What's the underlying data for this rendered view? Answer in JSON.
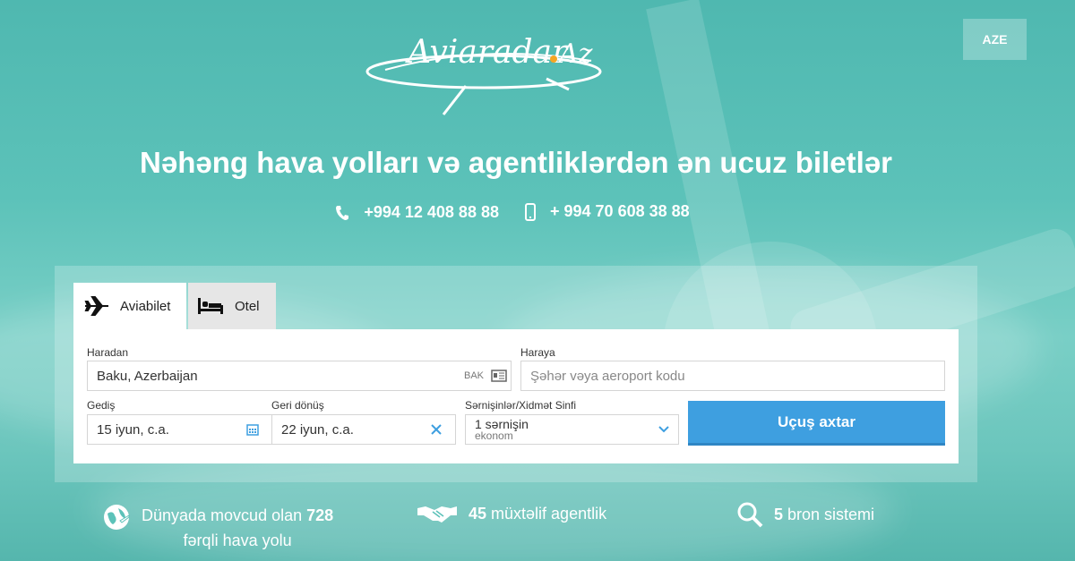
{
  "header": {
    "logo_text": "Aviaradar.Az",
    "language_button": "AZE"
  },
  "hero": {
    "title": "Nəhəng hava yolları və agentliklərdən ən ucuz biletlər",
    "phone_landline": "+994 12 408 88 88",
    "phone_mobile": "+ 994 70 608 38 88"
  },
  "tabs": [
    {
      "label": "Aviabilet",
      "icon": "airplane-icon",
      "active": true
    },
    {
      "label": "Otel",
      "icon": "bed-icon",
      "active": false
    }
  ],
  "form": {
    "from_label": "Haradan",
    "from_value": "Baku, Azerbaijan",
    "from_code": "BAK",
    "to_label": "Haraya",
    "to_placeholder": "Şəhər vəya aeroport kodu",
    "depart_label": "Gediş",
    "depart_value": "15 iyun, c.a.",
    "return_label": "Geri dönüş",
    "return_value": "22 iyun, c.a.",
    "pax_label": "Sərnişinlər/Xidmət Sinfi",
    "pax_value": "1 sərnişin",
    "class_value": "ekonom",
    "search_button": "Uçuş axtar"
  },
  "features": [
    {
      "icon": "globe-plane-icon",
      "pre": "Dünyada movcud olan ",
      "num": "728",
      "post": "fərqli hava yolu"
    },
    {
      "icon": "handshake-icon",
      "num": "45",
      "post": " müxtəlif agentlik"
    },
    {
      "icon": "search-icon",
      "num": "5",
      "post": " bron sistemi"
    }
  ],
  "colors": {
    "background": "#5cc2b9",
    "accent_button": "#3e9fe0",
    "text_light": "#ffffff"
  }
}
